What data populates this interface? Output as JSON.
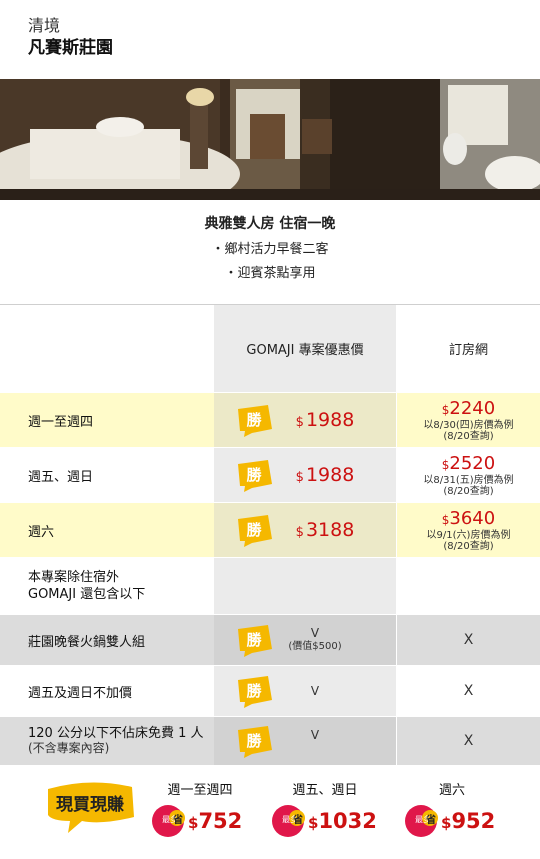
{
  "header": {
    "area": "清境",
    "hotel": "凡賽斯莊園"
  },
  "summary": {
    "title": "典雅雙人房 住宿一晚",
    "bullets": [
      "・鄉村活力早餐二客",
      "・迎賓茶點享用"
    ]
  },
  "table": {
    "col_gomaji": "GOMAJI 專案優惠價",
    "col_other": "訂房網",
    "win_label": "勝",
    "rows": [
      {
        "label": "週一至週四",
        "cur": "$",
        "price": "1988",
        "ref_cur": "$",
        "ref_price": "2240",
        "ref_note1": "以8/30(四)房價為例",
        "ref_note2": "(8/20查詢)"
      },
      {
        "label": "週五、週日",
        "cur": "$",
        "price": "1988",
        "ref_cur": "$",
        "ref_price": "2520",
        "ref_note1": "以8/31(五)房價為例",
        "ref_note2": "(8/20查詢)"
      },
      {
        "label": "週六",
        "cur": "$",
        "price": "3188",
        "ref_cur": "$",
        "ref_price": "3640",
        "ref_note1": "以9/1(六)房價為例",
        "ref_note2": "(8/20查詢)"
      }
    ],
    "extra_heading": [
      "本專案除住宿外",
      "GOMAJI 還包含以下"
    ],
    "extras": [
      {
        "label": "莊園晚餐火鍋雙人組",
        "sub_label": "",
        "gomaji": "V",
        "gomaji_note": "(價值$500)",
        "other": "X"
      },
      {
        "label": "週五及週日不加價",
        "sub_label": "",
        "gomaji": "V",
        "gomaji_note": "",
        "other": "X"
      },
      {
        "label": "120 公分以下不佔床免費 1 人",
        "sub_label": "(不含專案內容)",
        "gomaji": "V",
        "gomaji_note": "",
        "other": "X"
      }
    ]
  },
  "bottom": {
    "logo_text": "現買現賺",
    "badge_text1": "最多",
    "badge_text2": "省",
    "cols": [
      {
        "label": "週一至週四",
        "cur": "$",
        "amount": "752"
      },
      {
        "label": "週五、週日",
        "cur": "$",
        "amount": "1032"
      },
      {
        "label": "週六",
        "cur": "$",
        "amount": "952"
      }
    ]
  },
  "colors": {
    "accent_red": "#cc1111",
    "win_yellow": "#f5b800",
    "highlight_row": "#fffbc9"
  }
}
